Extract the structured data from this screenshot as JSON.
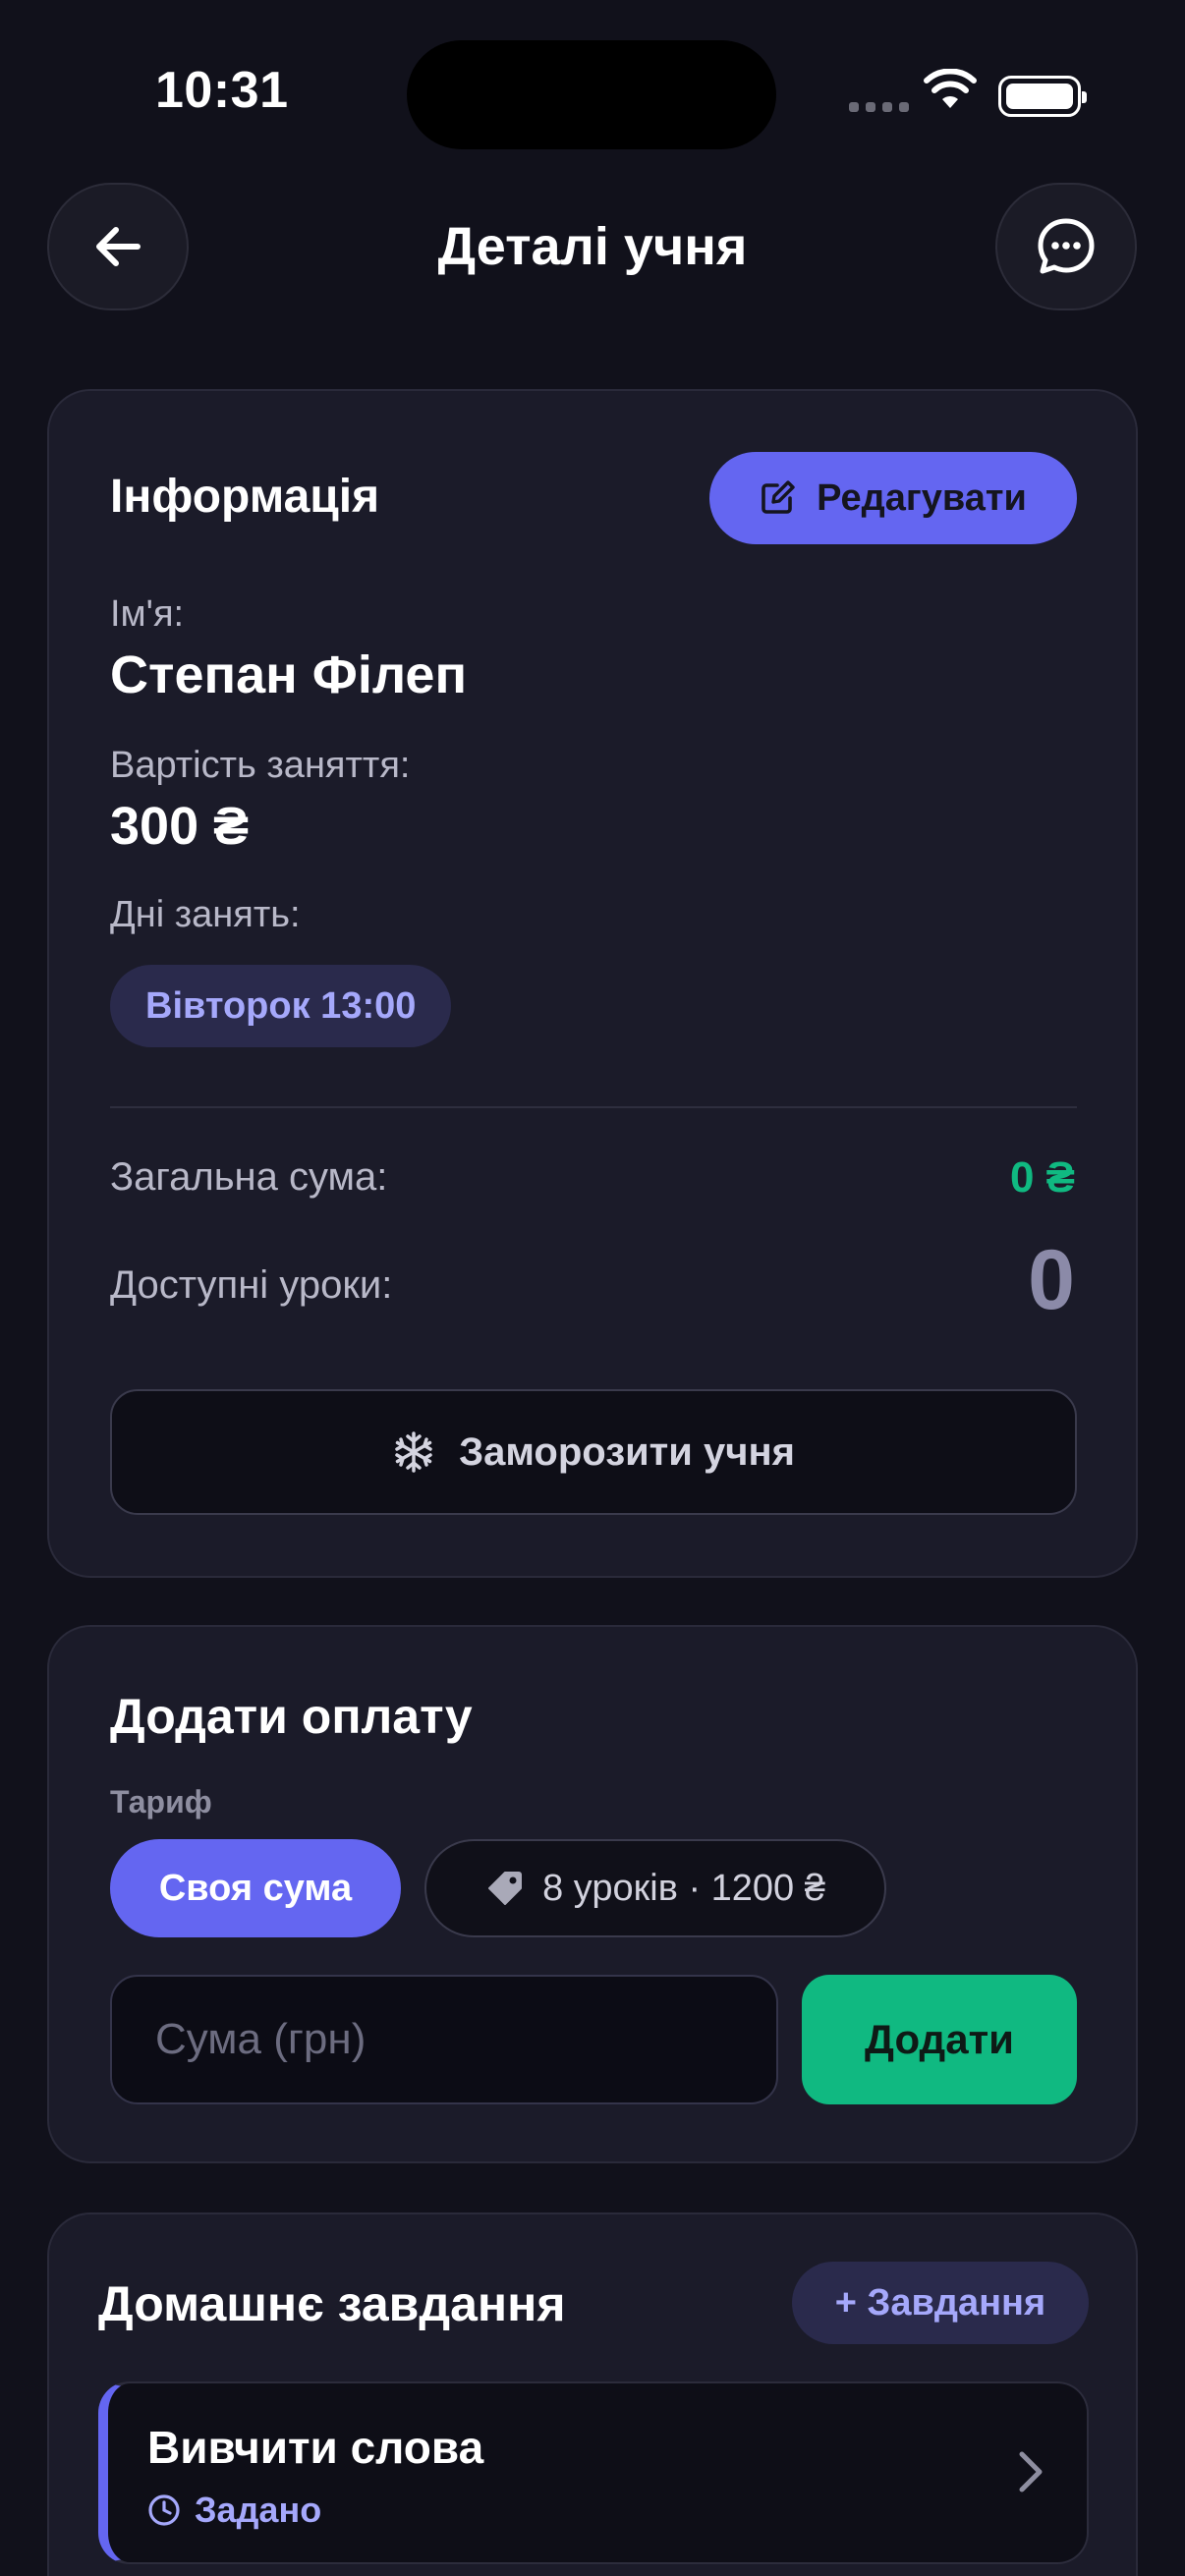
{
  "status_bar": {
    "time": "10:31"
  },
  "header": {
    "title": "Деталі учня"
  },
  "info": {
    "title": "Інформація",
    "edit_label": "Редагувати",
    "name_label": "Ім'я:",
    "name_value": "Степан Філеп",
    "price_label": "Вартість заняття:",
    "price_value": "300 ₴",
    "days_label": "Дні занять:",
    "days": [
      "Вівторок 13:00"
    ],
    "total_label": "Загальна сума:",
    "total_value": "0 ₴",
    "lessons_label": "Доступні уроки:",
    "lessons_value": "0",
    "freeze_label": "Заморозити учня"
  },
  "payment": {
    "title": "Додати оплату",
    "tariff_label": "Тариф",
    "tariff_custom": "Своя сума",
    "tariff_package": "8 уроків · 1200 ₴",
    "amount_placeholder": "Сума (грн)",
    "add_label": "Додати"
  },
  "homework": {
    "title": "Домашнє завдання",
    "add_label": "+ Завдання",
    "items": [
      {
        "title": "Вивчити слова",
        "status": "Задано"
      }
    ]
  },
  "colors": {
    "background": "#11111b",
    "card": "#1b1b29",
    "accent": "#6466f1",
    "success": "#10b981",
    "chip_text": "#a5a8fb"
  },
  "icons": [
    "back-arrow-icon",
    "chat-bubble-icon",
    "edit-icon",
    "snowflake-icon",
    "tag-icon",
    "clock-icon",
    "chevron-right-icon",
    "wifi-icon",
    "battery-icon"
  ]
}
